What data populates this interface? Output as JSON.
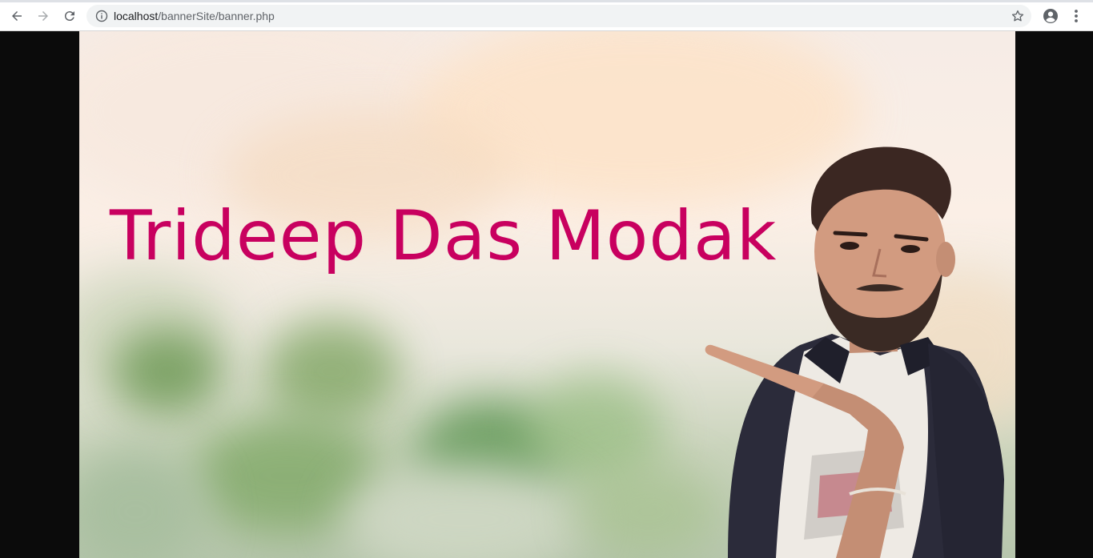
{
  "browser": {
    "url_host": "localhost",
    "url_path": "/bannerSite/banner.php",
    "icons": {
      "back": "back-arrow-icon",
      "forward": "forward-arrow-icon",
      "reload": "reload-icon",
      "info": "info-icon",
      "bookmark": "star-icon",
      "profile": "account-circle-icon",
      "menu": "kebab-menu-icon"
    }
  },
  "banner": {
    "title": "Trideep Das Modak",
    "title_color": "#c8005f",
    "background_image": "blurred-greenery-background",
    "subject_image": "man-pointing-at-himself"
  }
}
